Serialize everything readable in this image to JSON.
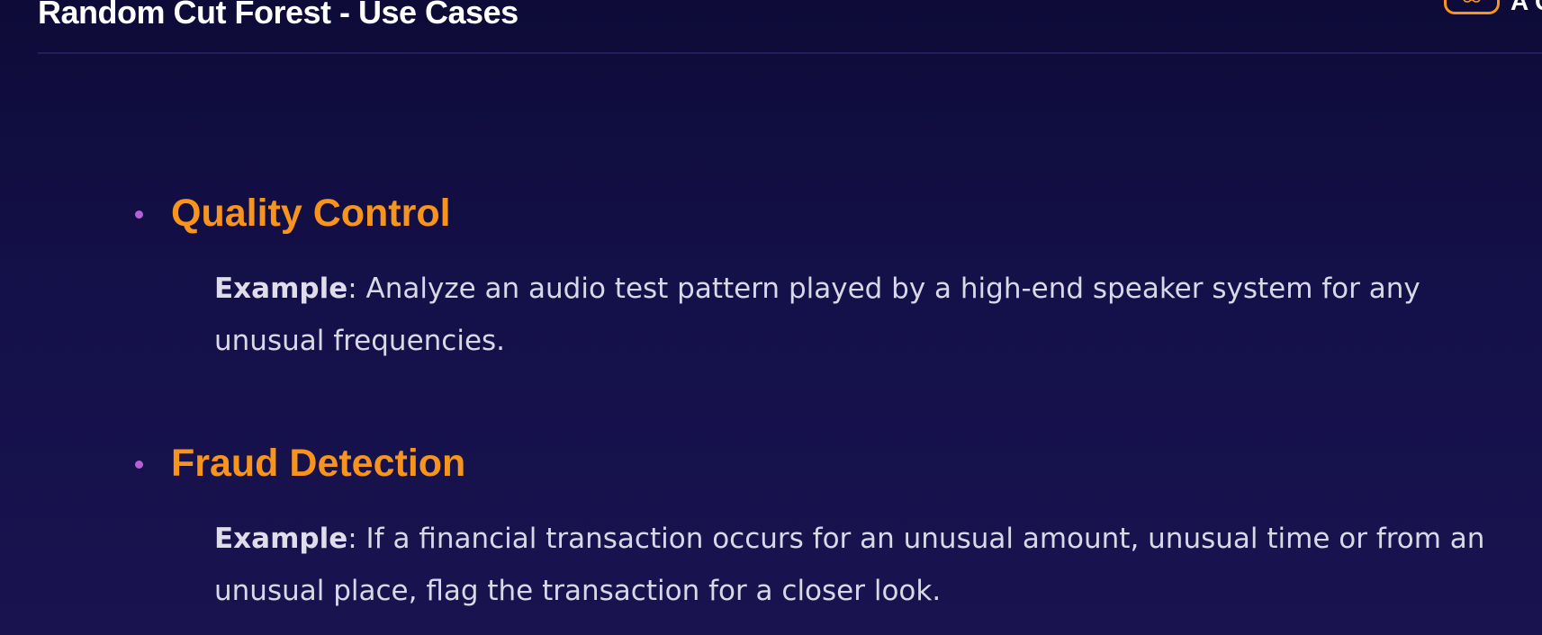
{
  "slide": {
    "title": "Random Cut Forest - Use Cases",
    "brand_text": "A C"
  },
  "colors": {
    "background_top": "#0e0b38",
    "background_bottom": "#19134f",
    "heading_accent": "#f7941d",
    "bullet": "#b460d6",
    "body_text": "#d9d8e6"
  },
  "use_cases": [
    {
      "heading": "Quality Control",
      "example_label": "Example",
      "example_text": ": Analyze an audio test pattern played by a high-end speaker system for any unusual frequencies."
    },
    {
      "heading": "Fraud Detection",
      "example_label": "Example",
      "example_text": ": If a financial transaction occurs for an unusual amount, unusual time or from an unusual place, flag the transaction for a closer look."
    }
  ],
  "icons": {
    "brand_logo": "brain-logo-icon",
    "bullet": "bullet-dot-icon"
  }
}
